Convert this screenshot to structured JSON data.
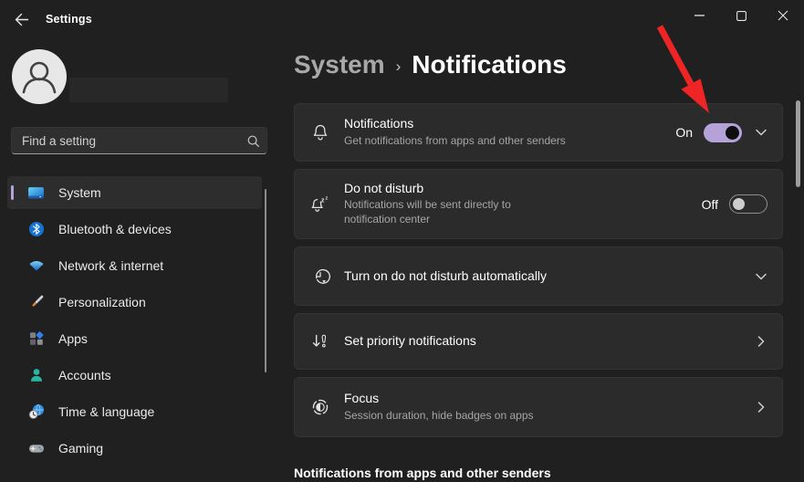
{
  "window": {
    "app_title": "Settings"
  },
  "sidebar": {
    "search": {
      "placeholder": "Find a setting"
    },
    "items": [
      {
        "label": "System",
        "icon": "system-icon",
        "selected": true
      },
      {
        "label": "Bluetooth & devices",
        "icon": "bluetooth-icon",
        "selected": false
      },
      {
        "label": "Network & internet",
        "icon": "network-icon",
        "selected": false
      },
      {
        "label": "Personalization",
        "icon": "personalization-icon",
        "selected": false
      },
      {
        "label": "Apps",
        "icon": "apps-icon",
        "selected": false
      },
      {
        "label": "Accounts",
        "icon": "accounts-icon",
        "selected": false
      },
      {
        "label": "Time & language",
        "icon": "time-language-icon",
        "selected": false
      },
      {
        "label": "Gaming",
        "icon": "gaming-icon",
        "selected": false
      }
    ]
  },
  "main": {
    "breadcrumb": {
      "parent": "System",
      "separator": "›",
      "current": "Notifications"
    },
    "cards": [
      {
        "icon": "bell-icon",
        "title": "Notifications",
        "subtitle": "Get notifications from apps and other senders",
        "toggle": {
          "state_label": "On",
          "on": true
        },
        "expander": "chevron-down"
      },
      {
        "icon": "bell-sleep-icon",
        "title": "Do not disturb",
        "subtitle": "Notifications will be sent directly to\nnotification center",
        "toggle": {
          "state_label": "Off",
          "on": false
        }
      },
      {
        "icon": "clock-history-icon",
        "title": "Turn on do not disturb automatically",
        "expander": "chevron-down"
      },
      {
        "icon": "priority-icon",
        "title": "Set priority notifications",
        "expander": "chevron-right"
      },
      {
        "icon": "focus-icon",
        "title": "Focus",
        "subtitle": "Session duration, hide badges on apps",
        "expander": "chevron-right"
      }
    ],
    "section_header": "Notifications from apps and other senders"
  },
  "annotation": {
    "type": "red-arrow",
    "points_at": "notifications-toggle"
  },
  "colors": {
    "background": "#202020",
    "card": "#2b2b2b",
    "accent": "#b5a2d8",
    "arrow_red": "#ee2524"
  }
}
